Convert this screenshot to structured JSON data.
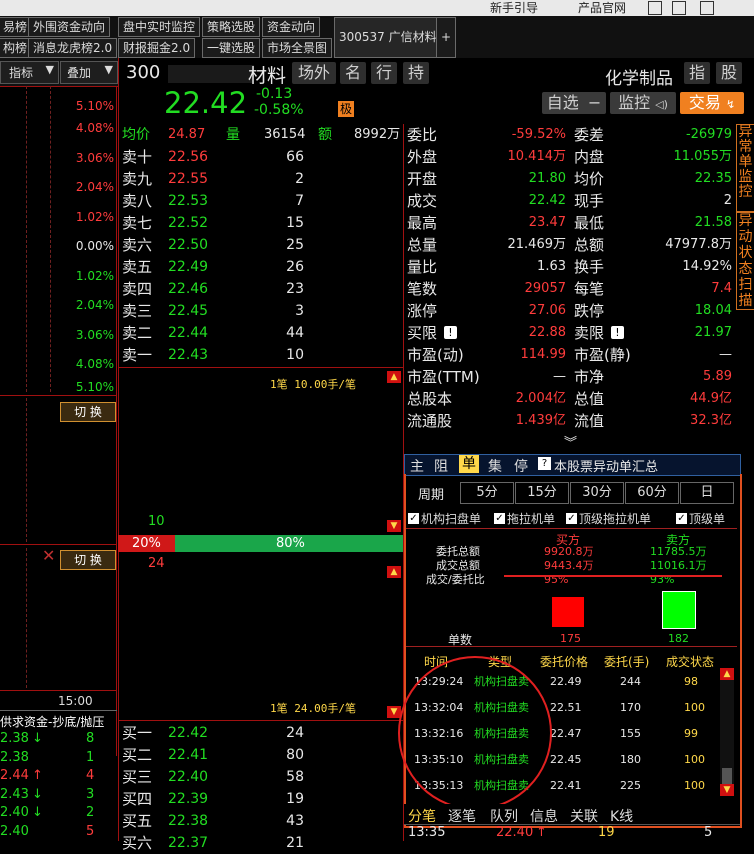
{
  "topbar": {
    "links": [
      "新手引导",
      "产品官网"
    ]
  },
  "tabs": {
    "row1": [
      "易榜",
      "外围资金动向",
      "盘中实时监控",
      "策略选股",
      "资金动向"
    ],
    "row2": [
      "构榜",
      "消息龙虎榜2.0",
      "财报掘金2.0",
      "一键选股",
      "市场全景图"
    ],
    "stock_tab": "300537 广信材料",
    "add": "+"
  },
  "left": {
    "indicator_btn": "指标",
    "overlay_btn": "叠加",
    "percents": [
      "5.10%",
      "4.08%",
      "3.06%",
      "2.04%",
      "1.02%",
      "0.00%",
      "1.02%",
      "2.04%",
      "3.06%",
      "4.08%",
      "5.10%"
    ],
    "switch_btn": "切 换",
    "time_label": "15:00",
    "fund_title": "供求资金-抄底/抛压",
    "fund_rows": [
      {
        "price": "2.38",
        "arrow": "↓",
        "n": "8",
        "up": false
      },
      {
        "price": "2.38",
        "arrow": "",
        "n": "1",
        "up": false
      },
      {
        "price": "2.44",
        "arrow": "↑",
        "n": "4",
        "up": true
      },
      {
        "price": "2.43",
        "arrow": "↓",
        "n": "3",
        "up": false
      },
      {
        "price": "2.40",
        "arrow": "↓",
        "n": "2",
        "up": false
      },
      {
        "price": "2.40",
        "arrow": "",
        "n": "5",
        "up": false
      }
    ]
  },
  "header": {
    "code": "300",
    "name_tail": "材料",
    "tags": [
      "场外",
      "名",
      "行",
      "持"
    ],
    "price": "22.42",
    "change": "-0.13",
    "change_pct": "-0.58%",
    "badge": "极",
    "industry": "化学制品",
    "ind_btn": "指",
    "stock_btn": "股",
    "watch_btn": "自选",
    "monitor_btn": "监控",
    "trade_btn": "交易"
  },
  "quote": {
    "avg_label": "均价",
    "avg": "24.87",
    "vol_label": "量",
    "vol": "36154",
    "amt_label": "额",
    "amt": "8992万"
  },
  "sells": [
    {
      "label": "卖十",
      "price": "22.56",
      "vol": "66",
      "up": true
    },
    {
      "label": "卖九",
      "price": "22.55",
      "vol": "2",
      "up": true
    },
    {
      "label": "卖八",
      "price": "22.53",
      "vol": "7",
      "up": false
    },
    {
      "label": "卖七",
      "price": "22.52",
      "vol": "15",
      "up": false
    },
    {
      "label": "卖六",
      "price": "22.50",
      "vol": "25",
      "up": false
    },
    {
      "label": "卖五",
      "price": "22.49",
      "vol": "26",
      "up": false
    },
    {
      "label": "卖四",
      "price": "22.46",
      "vol": "23",
      "up": false
    },
    {
      "label": "卖三",
      "price": "22.45",
      "vol": "3",
      "up": false
    },
    {
      "label": "卖二",
      "price": "22.44",
      "vol": "44",
      "up": false
    },
    {
      "label": "卖一",
      "price": "22.43",
      "vol": "10",
      "up": false
    }
  ],
  "buys": [
    {
      "label": "买一",
      "price": "22.42",
      "vol": "24"
    },
    {
      "label": "买二",
      "price": "22.41",
      "vol": "80"
    },
    {
      "label": "买三",
      "price": "22.40",
      "vol": "58"
    },
    {
      "label": "买四",
      "price": "22.39",
      "vol": "19"
    },
    {
      "label": "买五",
      "price": "22.38",
      "vol": "43"
    },
    {
      "label": "买六",
      "price": "22.37",
      "vol": "21"
    }
  ],
  "mid": {
    "avg_top": "1笔 10.00手/笔",
    "avg_bottom": "1笔 24.00手/笔",
    "bid_count": "10",
    "ask_count": "24",
    "buy_pct": "20%",
    "sell_pct": "80%",
    "buy_frac": 0.2
  },
  "stats": {
    "left": [
      {
        "label": "委比",
        "value": "-59.52%",
        "color": "red"
      },
      {
        "label": "外盘",
        "value": "10.414万",
        "color": "red"
      },
      {
        "label": "开盘",
        "value": "21.80",
        "color": "grn"
      },
      {
        "label": "成交",
        "value": "22.42",
        "color": "grn"
      },
      {
        "label": "最高",
        "value": "23.47",
        "color": "red"
      },
      {
        "label": "总量",
        "value": "21.469万",
        "color": "wht"
      },
      {
        "label": "量比",
        "value": "1.63",
        "color": "wht"
      },
      {
        "label": "笔数",
        "value": "29057",
        "color": "red"
      },
      {
        "label": "涨停",
        "value": "27.06",
        "color": "red"
      },
      {
        "label": "买限",
        "value": "22.88",
        "color": "red",
        "warn": true
      },
      {
        "label": "市盈(动)",
        "value": "114.99",
        "color": "red"
      },
      {
        "label": "市盈(TTM)",
        "value": "—",
        "color": "wht"
      },
      {
        "label": "总股本",
        "value": "2.004亿",
        "color": "red"
      },
      {
        "label": "流通股",
        "value": "1.439亿",
        "color": "red"
      }
    ],
    "right": [
      {
        "label": "委差",
        "value": "-26979",
        "color": "grn"
      },
      {
        "label": "内盘",
        "value": "11.055万",
        "color": "grn"
      },
      {
        "label": "均价",
        "value": "22.35",
        "color": "grn"
      },
      {
        "label": "现手",
        "value": "2",
        "color": "wht"
      },
      {
        "label": "最低",
        "value": "21.58",
        "color": "grn"
      },
      {
        "label": "总额",
        "value": "47977.8万",
        "color": "wht"
      },
      {
        "label": "换手",
        "value": "14.92%",
        "color": "wht"
      },
      {
        "label": "每笔",
        "value": "7.4",
        "color": "red"
      },
      {
        "label": "跌停",
        "value": "18.04",
        "color": "grn"
      },
      {
        "label": "卖限",
        "value": "21.97",
        "color": "grn",
        "warn": true
      },
      {
        "label": "市盈(静)",
        "value": "—",
        "color": "wht"
      },
      {
        "label": "市净",
        "value": "5.89",
        "color": "red"
      },
      {
        "label": "总值",
        "value": "44.9亿",
        "color": "red"
      },
      {
        "label": "流值",
        "value": "32.3亿",
        "color": "red"
      }
    ]
  },
  "side_tabs": [
    "异常单监控",
    "异动状态扫描"
  ],
  "panel": {
    "tabs": [
      "主",
      "阻",
      "单",
      "集",
      "停"
    ],
    "title": "本股票异动单汇总",
    "period_label": "周期",
    "periods": [
      "5分",
      "15分",
      "30分",
      "60分",
      "日"
    ],
    "checks": [
      "机构扫盘单",
      "拖拉机单",
      "顶级拖拉机单",
      "顶级单"
    ],
    "buy_head": "买方",
    "sell_head": "卖方",
    "rows": [
      {
        "label": "委托总额",
        "buy": "9920.8万",
        "sell": "11785.5万"
      },
      {
        "label": "成交总额",
        "buy": "9443.4万",
        "sell": "11016.1万"
      },
      {
        "label": "成交/委托比",
        "buy": "95%",
        "sell": "93%"
      }
    ],
    "buy_count": "175",
    "sell_count": "182",
    "count_label": "单数",
    "table_head": [
      "时间",
      "类型",
      "委托价格",
      "委托(手)",
      "成交状态"
    ],
    "table": [
      [
        "13:29:24",
        "机构扫盘卖",
        "22.49",
        "244",
        "98"
      ],
      [
        "13:32:04",
        "机构扫盘卖",
        "22.51",
        "170",
        "100"
      ],
      [
        "13:32:16",
        "机构扫盘卖",
        "22.47",
        "155",
        "99"
      ],
      [
        "13:35:10",
        "机构扫盘卖",
        "22.45",
        "180",
        "100"
      ],
      [
        "13:35:13",
        "机构扫盘卖",
        "22.41",
        "225",
        "100"
      ]
    ]
  },
  "bottom": {
    "tabs": [
      "分笔",
      "逐笔",
      "队列",
      "信息",
      "关联",
      "K线"
    ],
    "tick": {
      "time": "13:35",
      "price": "22.40",
      "arrow": "↑",
      "vol": "19",
      "n": "5"
    }
  },
  "colors": {
    "up": "#ff3c3c",
    "down": "#22dd22",
    "frame": "#a01010",
    "accent": "#ffd84a"
  }
}
